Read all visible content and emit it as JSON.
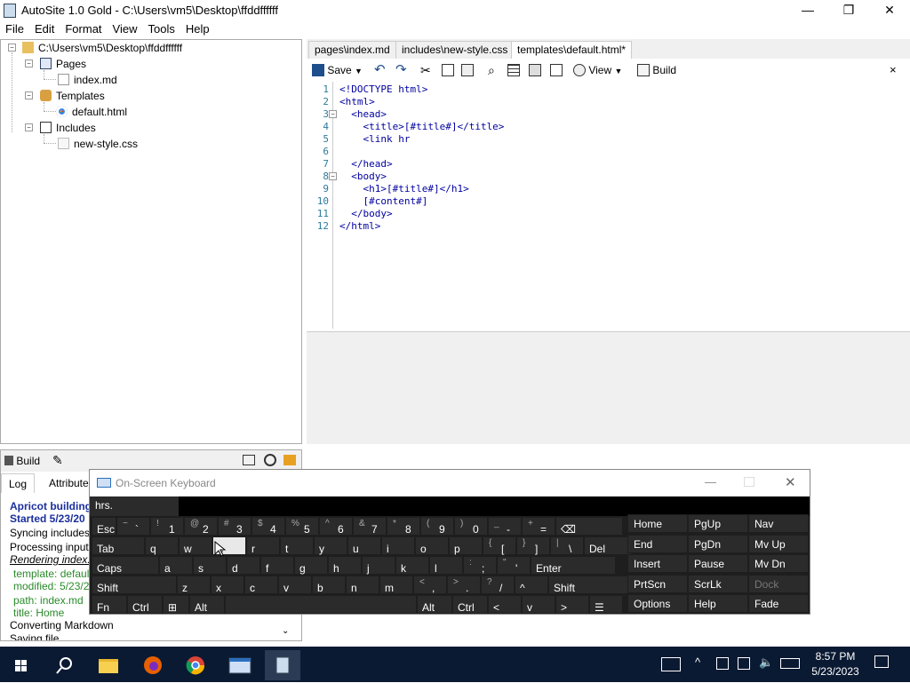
{
  "window": {
    "title": "AutoSite 1.0 Gold - C:\\Users\\vm5\\Desktop\\ffddffffff"
  },
  "menu": [
    "File",
    "Edit",
    "Format",
    "View",
    "Tools",
    "Help"
  ],
  "tree": {
    "root": "C:\\Users\\vm5\\Desktop\\ffddffffff",
    "pages": "Pages",
    "pages_file": "index.md",
    "templates": "Templates",
    "templates_file": "default.html",
    "includes": "Includes",
    "includes_file": "new-style.css"
  },
  "tabs": [
    "pages\\index.md",
    "includes\\new-style.css",
    "templates\\default.html*"
  ],
  "toolbar": {
    "save": "Save",
    "view": "View",
    "build": "Build",
    "close": "×"
  },
  "editor": {
    "lines": [
      "<!DOCTYPE html>",
      "<html>",
      "  <head>",
      "    <title>[#title#]</title>",
      "    <link hr",
      "",
      "  </head>",
      "  <body>",
      "    <h1>[#title#]</h1>",
      "    [#content#]",
      "  </body>",
      "</html>"
    ]
  },
  "bottom": {
    "build": "Build",
    "tabs": [
      "Log",
      "Attributes"
    ],
    "log": [
      "Apricot building",
      "Started 5/23/20",
      "Syncing includes",
      "Processing input",
      "Rendering index.",
      "template: defaul",
      "modified: 5/23/2",
      "path: index.md",
      "title: Home",
      "Converting Markdown",
      "Saving file"
    ]
  },
  "osk": {
    "title": "On-Screen Keyboard",
    "input": "hrs.",
    "rows": [
      [
        [
          "Esc",
          ""
        ],
        [
          "`",
          "~"
        ],
        [
          "1",
          "!"
        ],
        [
          "2",
          "@"
        ],
        [
          "3",
          "#"
        ],
        [
          "4",
          "$"
        ],
        [
          "5",
          "%"
        ],
        [
          "6",
          "^"
        ],
        [
          "7",
          "&"
        ],
        [
          "8",
          "*"
        ],
        [
          "9",
          "("
        ],
        [
          "0",
          ")"
        ],
        [
          "-",
          "_"
        ],
        [
          "=",
          "+"
        ],
        [
          "⌫",
          ""
        ]
      ],
      [
        [
          "Tab",
          ""
        ],
        [
          "q",
          ""
        ],
        [
          "w",
          ""
        ],
        [
          "e",
          ""
        ],
        [
          "r",
          ""
        ],
        [
          "t",
          ""
        ],
        [
          "y",
          ""
        ],
        [
          "u",
          ""
        ],
        [
          "i",
          ""
        ],
        [
          "o",
          ""
        ],
        [
          "p",
          ""
        ],
        [
          "[",
          "{"
        ],
        [
          "]",
          "}"
        ],
        [
          "\\",
          "|"
        ],
        [
          "Del",
          ""
        ]
      ],
      [
        [
          "Caps",
          ""
        ],
        [
          "a",
          ""
        ],
        [
          "s",
          ""
        ],
        [
          "d",
          ""
        ],
        [
          "f",
          ""
        ],
        [
          "g",
          ""
        ],
        [
          "h",
          ""
        ],
        [
          "j",
          ""
        ],
        [
          "k",
          ""
        ],
        [
          "l",
          ""
        ],
        [
          ";",
          ":"
        ],
        [
          "'",
          "\""
        ],
        [
          "Enter",
          ""
        ]
      ],
      [
        [
          "Shift",
          ""
        ],
        [
          "z",
          ""
        ],
        [
          "x",
          ""
        ],
        [
          "c",
          ""
        ],
        [
          "v",
          ""
        ],
        [
          "b",
          ""
        ],
        [
          "n",
          ""
        ],
        [
          "m",
          ""
        ],
        [
          ",",
          "<"
        ],
        [
          ".",
          ">"
        ],
        [
          "/",
          "?"
        ],
        [
          "^",
          ""
        ],
        [
          "Shift",
          ""
        ]
      ],
      [
        [
          "Fn",
          ""
        ],
        [
          "Ctrl",
          ""
        ],
        [
          "⊞",
          ""
        ],
        [
          "Alt",
          ""
        ],
        [
          "",
          ""
        ],
        [
          "Alt",
          ""
        ],
        [
          "Ctrl",
          ""
        ],
        [
          "<",
          ""
        ],
        [
          "v",
          ""
        ],
        [
          ">",
          ""
        ],
        [
          "☰",
          ""
        ]
      ]
    ],
    "side": [
      [
        "Home",
        "PgUp",
        "Nav"
      ],
      [
        "End",
        "PgDn",
        "Mv Up"
      ],
      [
        "Insert",
        "Pause",
        "Mv Dn"
      ],
      [
        "PrtScn",
        "ScrLk",
        "Dock"
      ],
      [
        "Options",
        "Help",
        "Fade"
      ]
    ]
  },
  "taskbar": {
    "time": "8:57 PM",
    "date": "5/23/2023"
  },
  "colors": {
    "accent": "#2d7a9e",
    "code": "#0000a0",
    "oskkey": "#2b2b2b"
  }
}
